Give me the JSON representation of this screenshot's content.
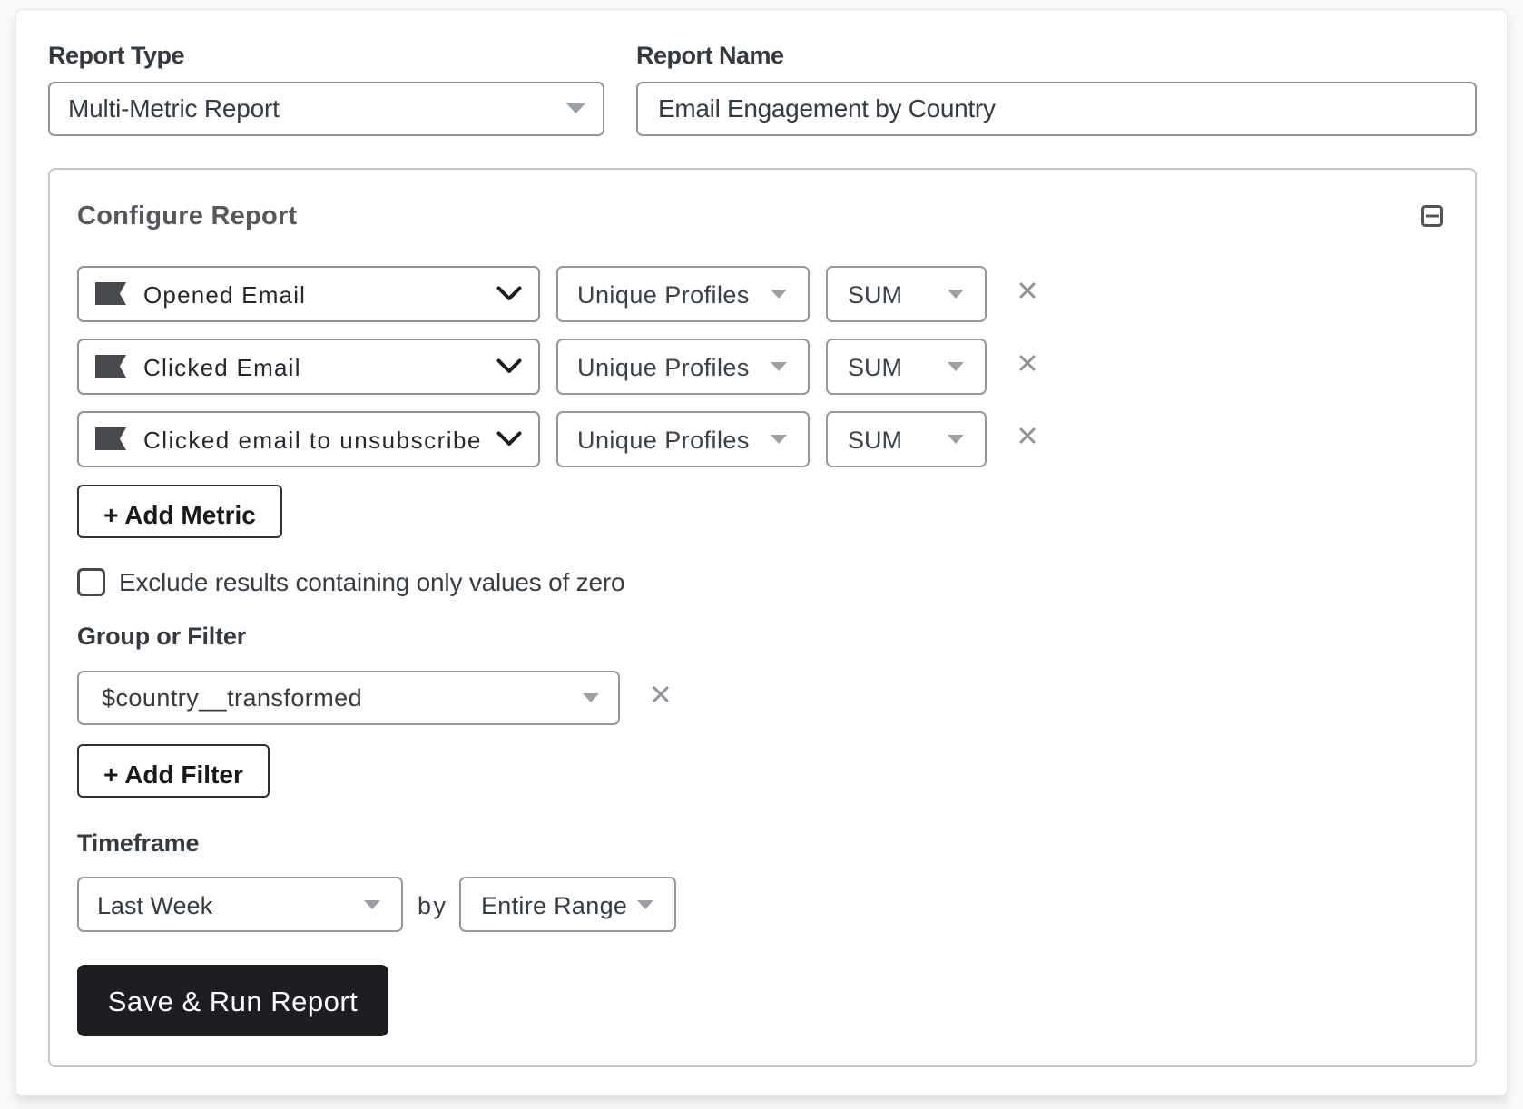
{
  "report_type": {
    "label": "Report Type",
    "value": "Multi-Metric Report"
  },
  "report_name": {
    "label": "Report Name",
    "value": "Email Engagement by Country"
  },
  "configure": {
    "title": "Configure Report",
    "metrics": [
      {
        "icon": "flag",
        "name": "Opened Email",
        "aggregation": "Unique Profiles",
        "function": "SUM"
      },
      {
        "icon": "flag",
        "name": "Clicked Email",
        "aggregation": "Unique Profiles",
        "function": "SUM"
      },
      {
        "icon": "flag",
        "name": "Clicked email to unsubscribe",
        "aggregation": "Unique Profiles",
        "function": "SUM"
      }
    ],
    "add_metric_label": "+ Add Metric",
    "exclude_zero": {
      "checked": false,
      "label": "Exclude results containing only values of zero"
    },
    "group_or_filter": {
      "label": "Group or Filter",
      "value": "$country__transformed"
    },
    "add_filter_label": "+ Add Filter",
    "timeframe": {
      "label": "Timeframe",
      "value": "Last Week",
      "by_label": "by",
      "by_value": "Entire Range"
    },
    "save_button_label": "Save & Run Report"
  },
  "colors": {
    "accent_dark": "#1c1e21",
    "control_border": "#92969b",
    "icon_gray": "#8f959b",
    "text_dark": "#23282d",
    "label": "#333a41"
  }
}
